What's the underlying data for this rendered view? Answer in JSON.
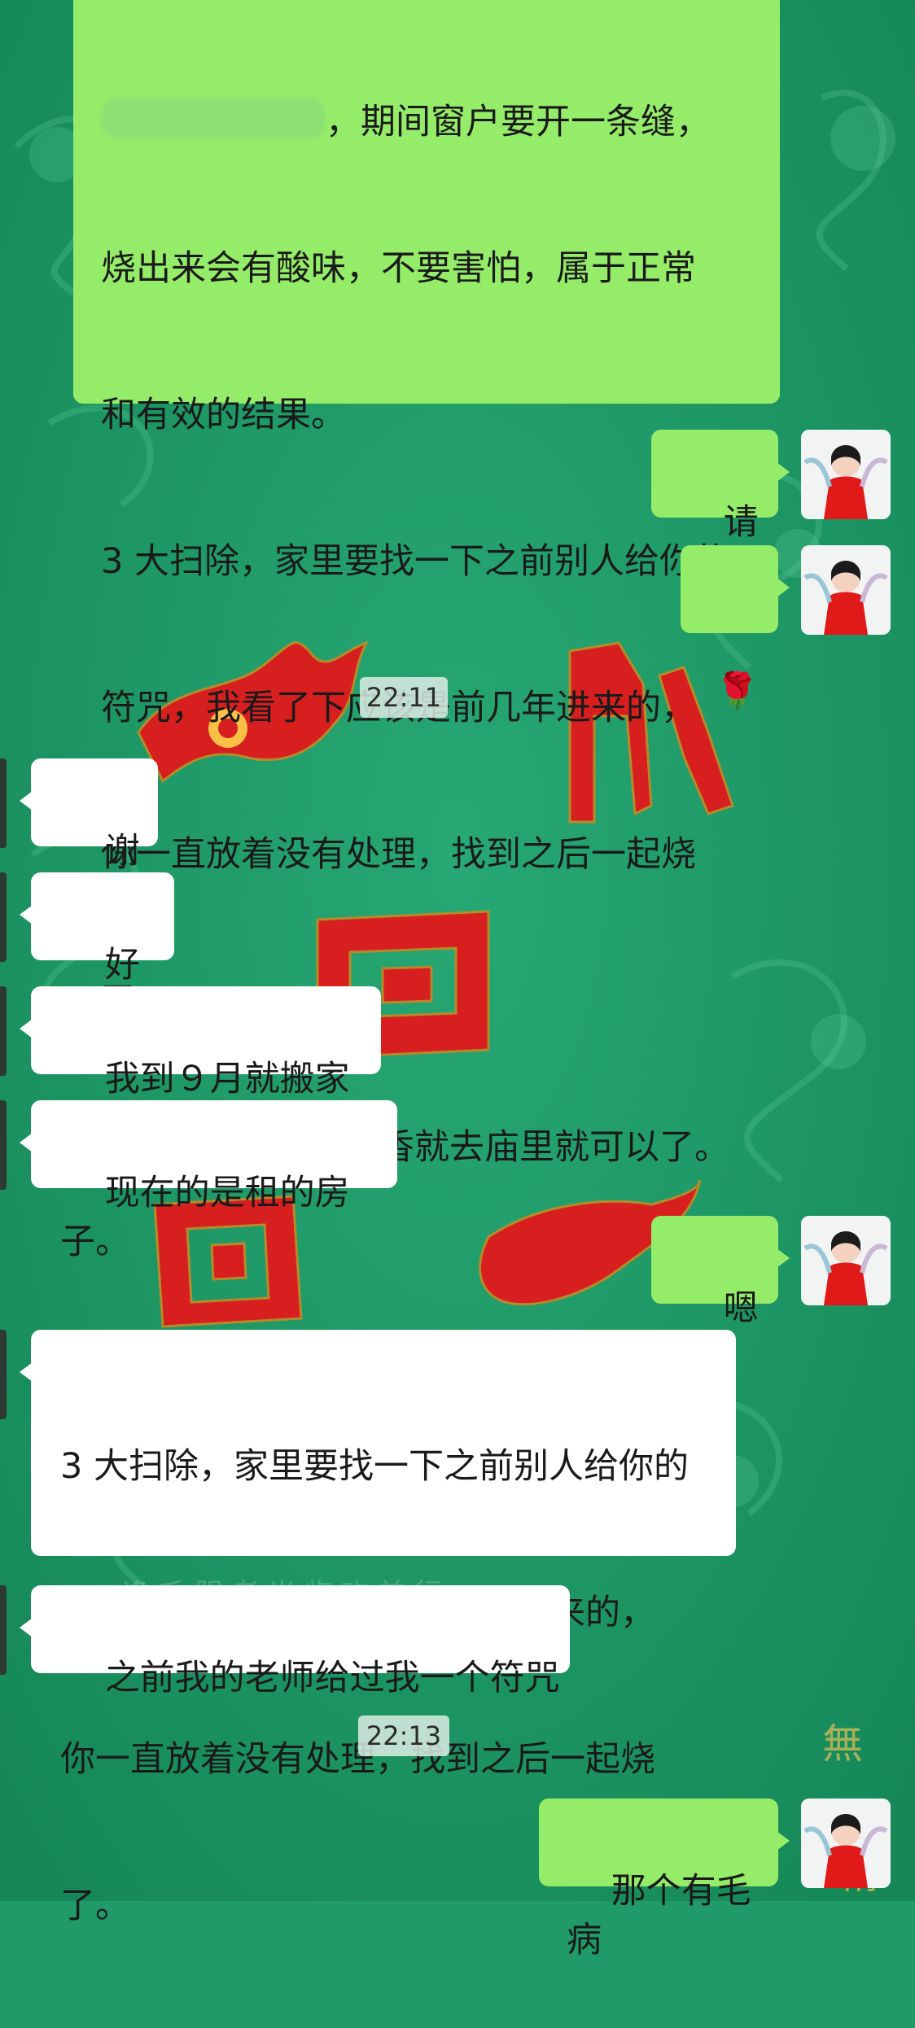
{
  "messages": [
    {
      "id": "m1",
      "from": "me",
      "lines": [
        "",
        "，期间窗户要开一条缝，",
        "烧出来会有酸味，不要害怕，属于正常",
        "和有效的结果。",
        "3 大扫除，家里要找一下之前别人给你的",
        "符咒，我看了下应该是前几年进来的，",
        "你一直放着没有处理，找到之后一起烧",
        "了。",
        "4 之后如果想要上香就去庙里就可以了。"
      ]
    },
    {
      "id": "m2",
      "from": "me",
      "text": "请收"
    },
    {
      "id": "m3",
      "from": "me",
      "icon": "rose-icon",
      "text": "🌹"
    },
    {
      "id": "m4",
      "from": "other",
      "text": "谢谢"
    },
    {
      "id": "m5",
      "from": "other",
      "text": "好的。"
    },
    {
      "id": "m6",
      "from": "other",
      "text": "我到９月就搬家了"
    },
    {
      "id": "m7",
      "from": "other",
      "text": "现在的是租的房子。"
    },
    {
      "id": "m8",
      "from": "me",
      "text": "嗯呢"
    },
    {
      "id": "m9",
      "from": "other",
      "lines": [
        "3 大扫除，家里要找一下之前别人给你的",
        "符咒，我看了下应该是前几年进来的，",
        "你一直放着没有处理，找到之后一起烧",
        "了。"
      ]
    },
    {
      "id": "m10",
      "from": "other",
      "text": "之前我的老师给过我一个符咒"
    },
    {
      "id": "m11",
      "from": "me",
      "text": "那个有毛病"
    }
  ],
  "timestamps": {
    "t1": "22:11",
    "t2": "22:13"
  },
  "colors": {
    "background": "#1f9a68",
    "outgoing_bubble": "#95ec69",
    "incoming_bubble": "#ffffff",
    "timestamp_bg": "#dcece4",
    "decor_red": "#d71f1f"
  }
}
